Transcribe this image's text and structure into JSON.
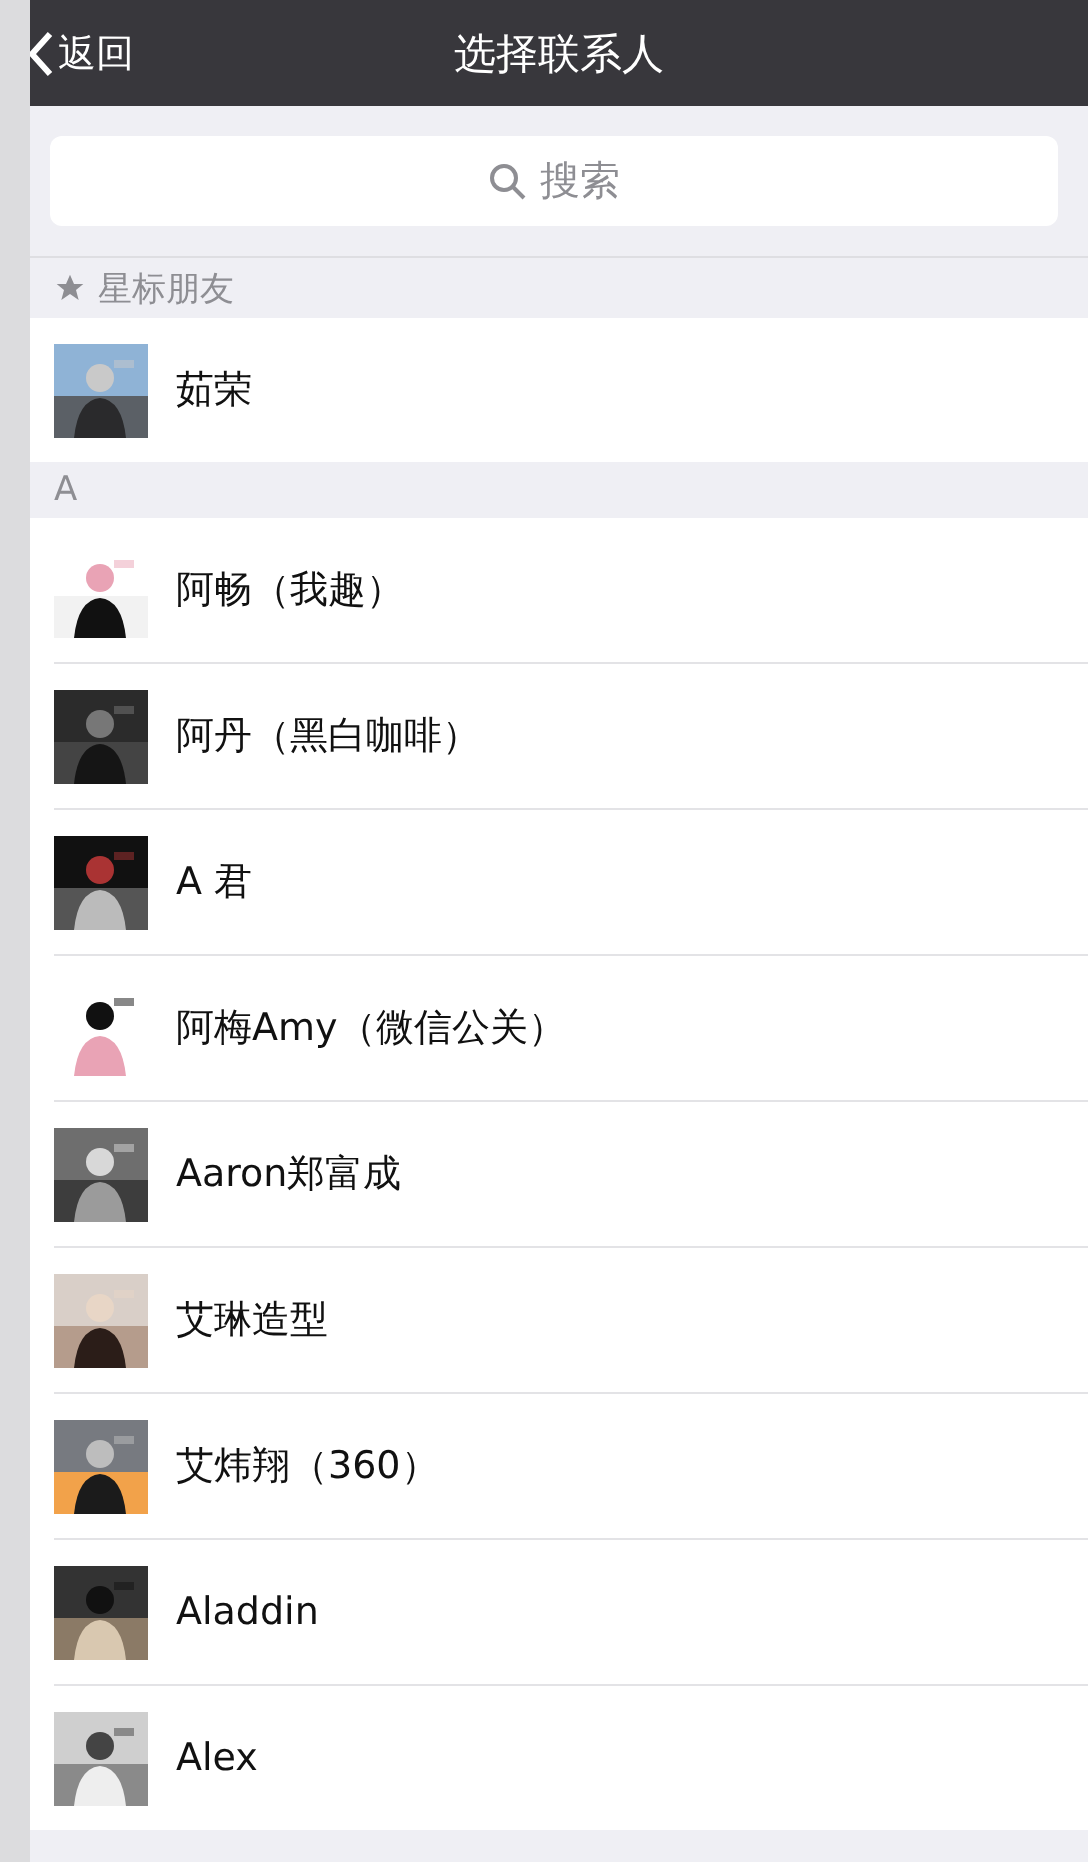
{
  "nav_bar": {
    "back": "返回",
    "title": "选择联系人"
  },
  "search": {
    "placeholder": "搜索"
  },
  "sections": [
    {
      "header": "星标朋友",
      "starred": true,
      "contacts": [
        {
          "name": "茹荣"
        }
      ]
    },
    {
      "header": "A",
      "starred": false,
      "contacts": [
        {
          "name": "阿畅（我趣）"
        },
        {
          "name": "阿丹（黑白咖啡）"
        },
        {
          "name": "A 君"
        },
        {
          "name": "阿梅Amy（微信公关）"
        },
        {
          "name": "Aaron郑富成"
        },
        {
          "name": "艾琳造型"
        },
        {
          "name": "艾炜翔（360）"
        },
        {
          "name": "Aladdin"
        },
        {
          "name": "Alex"
        }
      ]
    }
  ]
}
